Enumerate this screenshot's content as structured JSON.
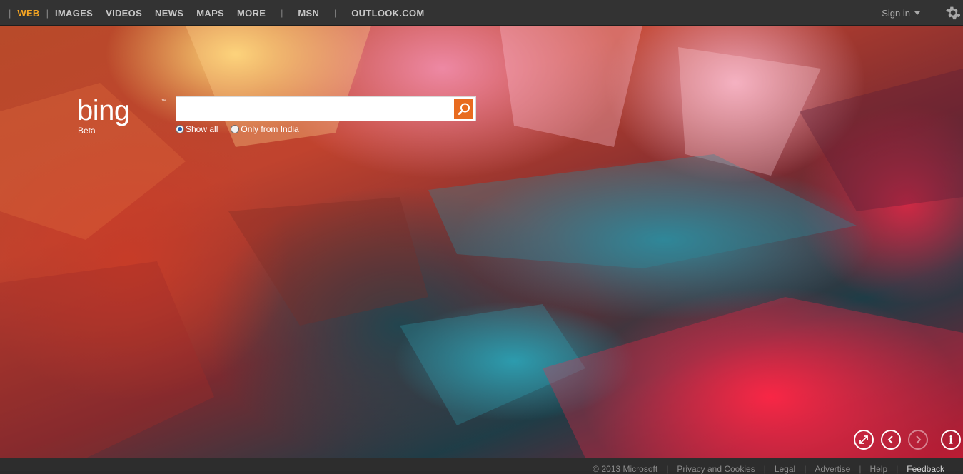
{
  "nav": {
    "items": [
      {
        "label": "WEB",
        "active": true
      },
      {
        "label": "IMAGES",
        "active": false
      },
      {
        "label": "VIDEOS",
        "active": false
      },
      {
        "label": "NEWS",
        "active": false
      },
      {
        "label": "MAPS",
        "active": false
      },
      {
        "label": "MORE",
        "active": false
      }
    ],
    "extra": [
      {
        "label": "MSN"
      },
      {
        "label": "OUTLOOK.COM"
      }
    ],
    "signin_label": "Sign in",
    "settings_icon": "gear-icon"
  },
  "logo": {
    "text": "bing",
    "tag": "Beta"
  },
  "search": {
    "value": "",
    "placeholder": "",
    "button_icon": "search-icon",
    "scope_options": [
      {
        "label": "Show all",
        "checked": true
      },
      {
        "label": "Only from India",
        "checked": false
      }
    ]
  },
  "controls": {
    "icons": [
      "expand-icon",
      "previous-arrow-icon",
      "next-arrow-icon",
      "info-icon"
    ]
  },
  "footer": {
    "copyright": "© 2013 Microsoft",
    "links": [
      "Privacy and Cookies",
      "Legal",
      "Advertise",
      "Help",
      "Feedback"
    ]
  },
  "colors": {
    "accent": "#f6a623",
    "search_button": "#e86b1f",
    "topbar": "#333333"
  }
}
